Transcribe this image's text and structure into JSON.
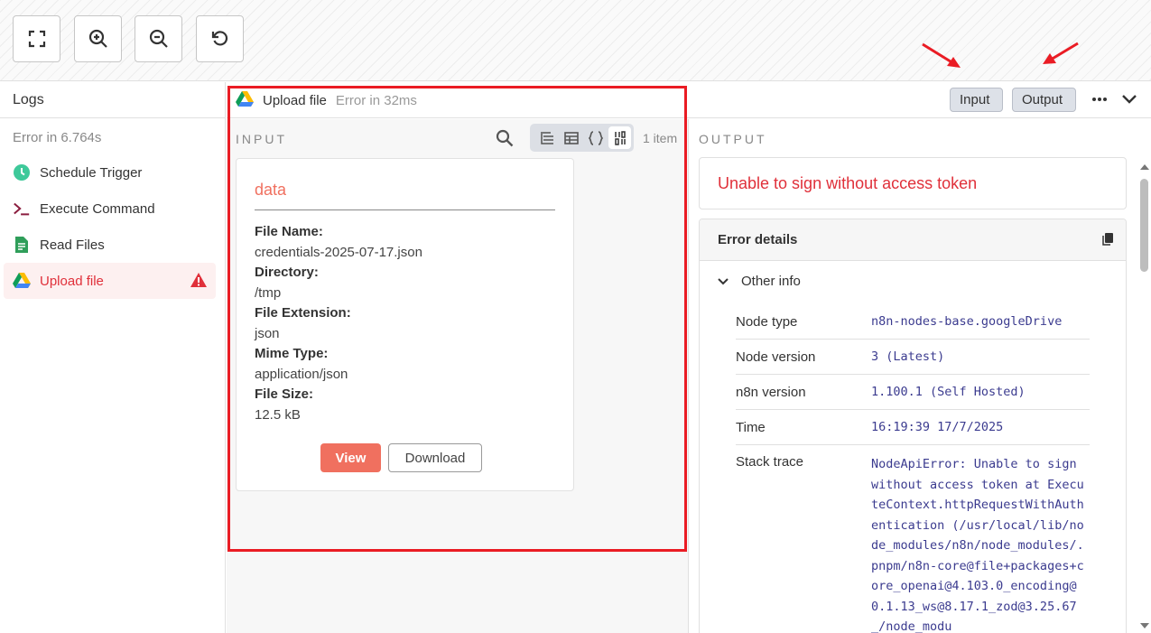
{
  "logs": {
    "title": "Logs",
    "status": "Error in 6.764s",
    "items": [
      {
        "label": "Schedule Trigger",
        "icon": "clock-icon"
      },
      {
        "label": "Execute Command",
        "icon": "terminal-icon"
      },
      {
        "label": "Read Files",
        "icon": "file-icon"
      },
      {
        "label": "Upload file",
        "icon": "google-drive-icon",
        "active": true,
        "status_icon": "warning-icon"
      }
    ]
  },
  "run_header": {
    "node_name": "Upload file",
    "node_status": "Error in 32ms",
    "input_label": "Input",
    "output_label": "Output"
  },
  "input": {
    "label": "INPUT",
    "item_count": "1 item",
    "card": {
      "title": "data",
      "fields": [
        {
          "key": "File Name:",
          "value": "credentials-2025-07-17.json"
        },
        {
          "key": "Directory:",
          "value": "/tmp"
        },
        {
          "key": "File Extension:",
          "value": "json"
        },
        {
          "key": "Mime Type:",
          "value": "application/json"
        },
        {
          "key": "File Size:",
          "value": "12.5 kB"
        }
      ],
      "view_label": "View",
      "download_label": "Download"
    }
  },
  "output": {
    "label": "OUTPUT",
    "error_message": "Unable to sign without access token",
    "details_title": "Error details",
    "other_info_label": "Other info",
    "info": [
      {
        "key": "Node type",
        "value": "n8n-nodes-base.googleDrive"
      },
      {
        "key": "Node version",
        "value": "3 (Latest)"
      },
      {
        "key": "n8n version",
        "value": "1.100.1 (Self Hosted)"
      },
      {
        "key": "Time",
        "value": "16:19:39 17/7/2025"
      },
      {
        "key": "Stack trace",
        "value": "NodeApiError: Unable to sign without access token at ExecuteContext.httpRequestWithAuthentication (/usr/local/lib/node_modules/n8n/node_modules/.pnpm/n8n-core@file+packages+core_openai@4.103.0_encoding@0.1.13_ws@8.17.1_zod@3.25.67_/node_modu"
      }
    ]
  },
  "colors": {
    "error": "#e0303a",
    "accent": "#f0705f",
    "highlight_box": "#ea1c24"
  }
}
